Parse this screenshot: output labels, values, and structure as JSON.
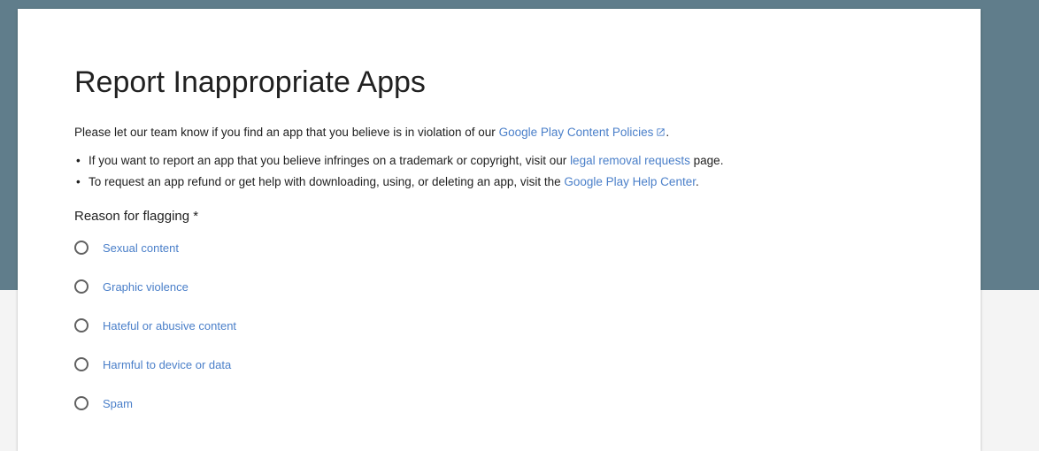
{
  "page": {
    "title": "Report Inappropriate Apps",
    "intro_text": "Please let our team know if you find an app that you believe is in violation of our",
    "intro_link": "Google Play Content Policies",
    "intro_end": ".",
    "bullets": [
      {
        "before": "If you want to report an app that you believe infringes on a trademark or copyright, visit our",
        "link": "legal removal requests",
        "after": "page."
      },
      {
        "before": "To request an app refund or get help with downloading, using, or deleting an app, visit the",
        "link": "Google Play Help Center",
        "after": "."
      }
    ],
    "bullet_char": "•",
    "reason_label": "Reason for flagging *",
    "reasons": [
      "Sexual content",
      "Graphic violence",
      "Hateful or abusive content",
      "Harmful to device or data",
      "Spam"
    ]
  },
  "colors": {
    "header_band": "#607d8b",
    "link": "#4a7fc9",
    "text": "#212121",
    "background": "#f4f4f4"
  },
  "icons": {
    "external_link": "external-link-icon",
    "radio": "radio-unchecked-icon"
  }
}
